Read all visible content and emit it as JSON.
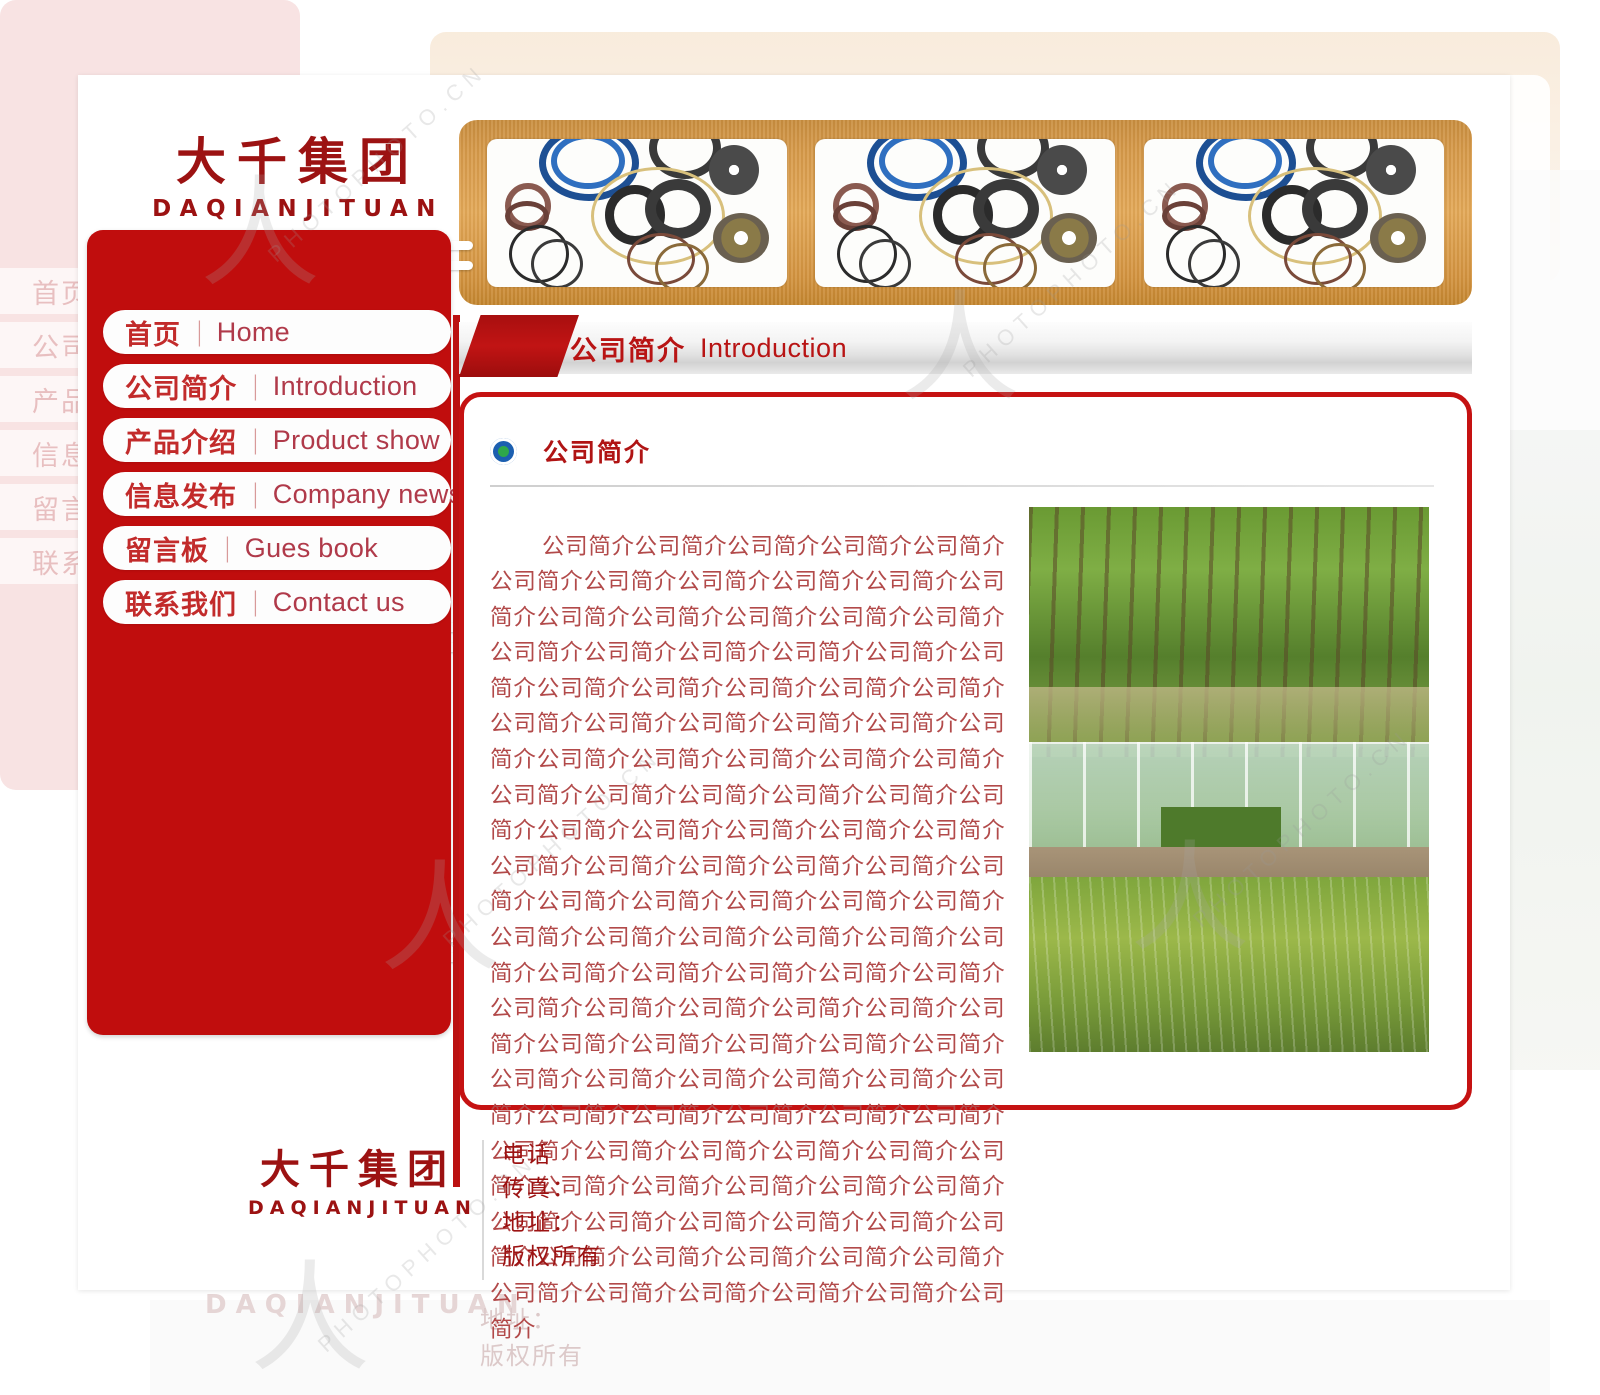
{
  "brand": {
    "cn": "大千集团",
    "en": "DAQIANJITUAN"
  },
  "nav": {
    "items": [
      {
        "cn": "首页",
        "sep": "|",
        "en": "Home"
      },
      {
        "cn": "公司简介",
        "sep": "|",
        "en": "Introduction"
      },
      {
        "cn": "产品介绍",
        "sep": "|",
        "en": "Product show"
      },
      {
        "cn": "信息发布",
        "sep": "|",
        "en": "Company news"
      },
      {
        "cn": "留言板",
        "sep": "|",
        "en": "Gues book"
      },
      {
        "cn": "联系我们",
        "sep": "|",
        "en": "Contact us"
      }
    ]
  },
  "titlebar": {
    "cn": "公司简介",
    "en": "Introduction"
  },
  "content": {
    "section_title": "公司简介",
    "bullet_icon": "bullseye-icon",
    "body_text": "公司简介公司简介公司简介公司简介公司简介公司简介公司简介公司简介公司简介公司简介公司简介公司简介公司简介公司简介公司简介公司简介公司简介公司简介公司简介公司简介公司简介公司简介公司简介公司简介公司简介公司简介公司简介公司简介公司简介公司简介公司简介公司简介公司简介公司简介公司简介公司简介公司简介公司简介公司简介公司简介公司简介公司简介公司简介公司简介公司简介公司简介公司简介公司简介公司简介公司简介公司简介公司简介公司简介公司简介公司简介公司简介公司简介公司简介公司简介公司简介公司简介公司简介公司简介公司简介公司简介公司简介公司简介公司简介公司简介公司简介公司简介公司简介公司简介公司简介公司简介公司简介公司简介公司简介公司简介公司简介公司简介公司简介公司简介公司简介公司简介公司简介公司简介公司简介公司简介公司简介公司简介公司简介公司简介公司简介公司简介公司简介公司简介公司简介公司简介公司简介公司简介公司简介公司简介公司简介公司简介公司简介公司简介公司简介公司简介公司简介公司简介公司简介公司简介公司简介公司简介公司简介公司简介公司简介公司简介公司简介公司简介",
    "photo_alt": "park-garden-photo"
  },
  "banner": {
    "thumbnails": [
      "seal-rings-photo",
      "seal-rings-photo",
      "seal-rings-photo"
    ]
  },
  "footer": {
    "brand_cn": "大千集团",
    "brand_en": "DAQIANJITUAN",
    "lines": [
      "电话",
      "传真：",
      "地址：",
      "版权所有"
    ]
  },
  "ghost": {
    "nav_labels": [
      "首页",
      "公司",
      "产品",
      "信息",
      "留言",
      "联系"
    ],
    "brand_en": "DAQIANJITUAN",
    "foot_lines": [
      "地址：",
      "版权所有"
    ]
  },
  "watermark": {
    "text_top": "PHOTOPHOTO.CN",
    "text_mid": "PHOTOPHOTO.CN",
    "text_bottom": "PHOTOPHOTO.CN"
  },
  "colors": {
    "brand_red": "#9c1212",
    "nav_red": "#c00d0d",
    "border_red": "#c51212",
    "banner_tan": "#e3a857",
    "text_red": "#b24a4a",
    "bullet_blue": "#1b5fb0",
    "bullet_green": "#2ea84a"
  }
}
